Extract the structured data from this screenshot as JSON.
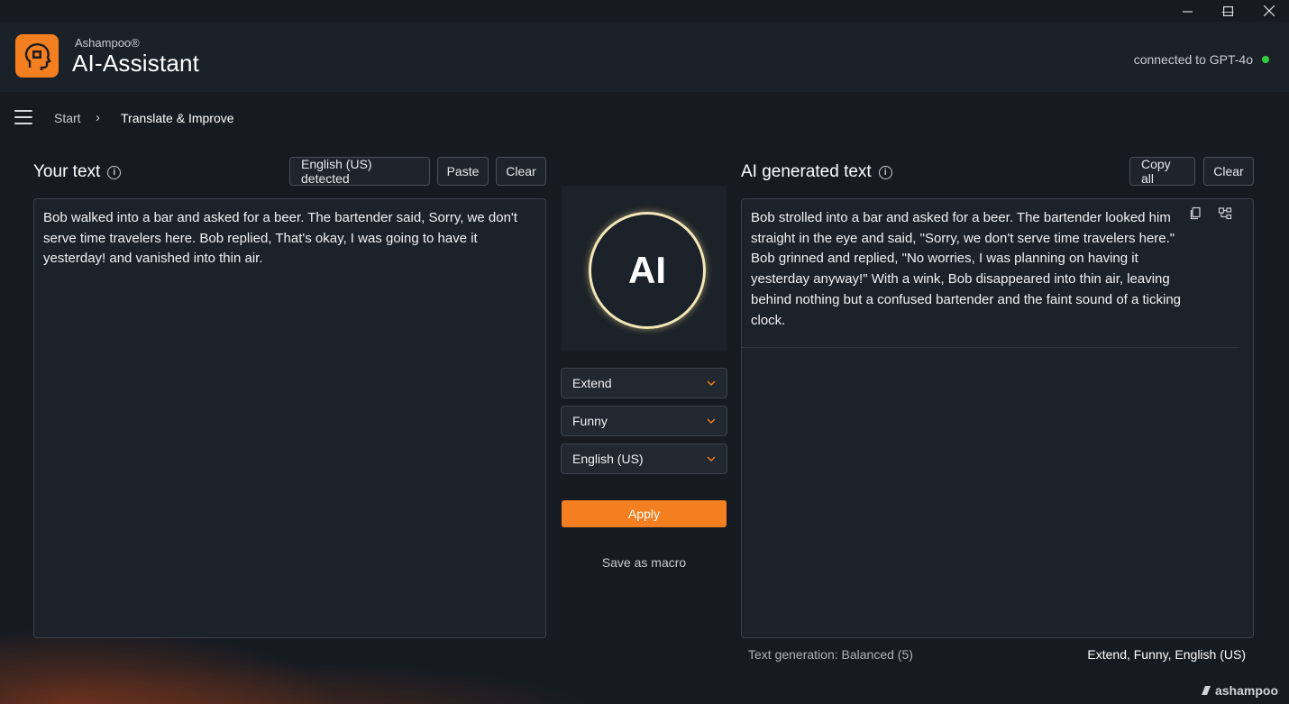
{
  "window": {
    "minimize": "—",
    "maximize": "☐",
    "close": "✕"
  },
  "header": {
    "brand_small": "Ashampoo®",
    "brand_big": "AI-Assistant",
    "connection": "connected to GPT-4o",
    "status_color": "#2ecc40",
    "accent_color": "#f47f20"
  },
  "breadcrumb": {
    "start": "Start",
    "separator": "›",
    "current": "Translate & Improve"
  },
  "input_panel": {
    "title": "Your text",
    "language_detected": "English (US) detected",
    "paste_label": "Paste",
    "clear_label": "Clear",
    "text": "Bob walked into a bar and asked for a beer. The bartender said, Sorry, we don't serve time travelers here. Bob replied, That's okay, I was going to have it yesterday! and vanished into thin air."
  },
  "center": {
    "ai_label": "AI",
    "mode": "Extend",
    "tone": "Funny",
    "language": "English (US)",
    "apply_label": "Apply",
    "save_macro_label": "Save as macro"
  },
  "output_panel": {
    "title": "AI generated text",
    "copy_all_label": "Copy all",
    "clear_label": "Clear",
    "text": "Bob strolled into a bar and asked for a beer. The bartender looked him straight in the eye and said, \"Sorry, we don't serve time travelers here.\" Bob grinned and replied, \"No worries, I was planning on having it yesterday anyway!\" With a wink, Bob disappeared into thin air, leaving behind nothing but a confused bartender and the faint sound of a ticking clock."
  },
  "footer": {
    "generation": "Text generation:  Balanced (5)",
    "settings": "Extend, Funny, English (US)",
    "watermark": "ashampoo"
  }
}
